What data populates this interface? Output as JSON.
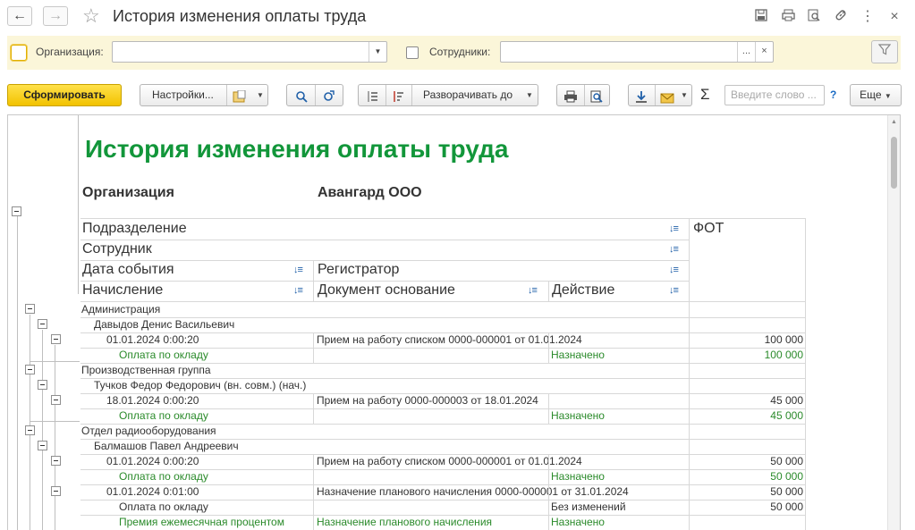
{
  "window": {
    "title": "История изменения оплаты труда",
    "back_icon": "←",
    "forward_icon": "→",
    "favorite_icon": "☆",
    "close_icon": "×",
    "more_icon": "⋮"
  },
  "filters": {
    "organization_label": "Организация:",
    "organization_value": "",
    "employees_label": "Сотрудники:",
    "employees_value": "",
    "employees_select": "...",
    "employees_clear": "×"
  },
  "toolbar": {
    "generate": "Сформировать",
    "settings": "Настройки...",
    "expand_to": "Разворачивать до",
    "search_placeholder": "Введите слово ...",
    "help": "?",
    "more": "Еще",
    "sum_icon": "Σ"
  },
  "report": {
    "title": "История изменения оплаты труда",
    "org_label": "Организация",
    "org_value": "Авангард ООО",
    "headers": {
      "department": "Подразделение",
      "employee": "Сотрудник",
      "event_date": "Дата события",
      "registrar": "Регистратор",
      "accrual": "Начисление",
      "base_document": "Документ основание",
      "action": "Действие",
      "fot": "ФОТ"
    },
    "rows": [
      {
        "kind": "dept",
        "c1": "Администрация",
        "c2": "",
        "c3": "",
        "fot": ""
      },
      {
        "kind": "emp",
        "c1": "Давыдов Денис Васильевич",
        "c2": "",
        "c3": "",
        "fot": ""
      },
      {
        "kind": "event",
        "c1": "01.01.2024 0:00:20",
        "c2": "Прием на работу списком 0000-000001 от 01.01.2024",
        "c3": "",
        "fot": "100 000"
      },
      {
        "kind": "accrual",
        "c1": "Оплата по окладу",
        "c2": "",
        "c3": "Назначено",
        "fot": "100 000"
      },
      {
        "kind": "dept",
        "c1": "Производственная группа",
        "c2": "",
        "c3": "",
        "fot": ""
      },
      {
        "kind": "emp",
        "c1": "Тучков Федор Федорович (вн. совм.) (нач.)",
        "c2": "",
        "c3": "",
        "fot": ""
      },
      {
        "kind": "event",
        "c1": "18.01.2024 0:00:20",
        "c2": "Прием на работу 0000-000003 от 18.01.2024",
        "c3": "",
        "fot": "45 000"
      },
      {
        "kind": "accrual",
        "c1": "Оплата по окладу",
        "c2": "",
        "c3": "Назначено",
        "fot": "45 000"
      },
      {
        "kind": "dept",
        "c1": "Отдел радиооборудования",
        "c2": "",
        "c3": "",
        "fot": ""
      },
      {
        "kind": "emp",
        "c1": "Балмашов Павел Андреевич",
        "c2": "",
        "c3": "",
        "fot": ""
      },
      {
        "kind": "event",
        "c1": "01.01.2024 0:00:20",
        "c2": "Прием на работу списком 0000-000001 от 01.01.2024",
        "c3": "",
        "fot": "50 000"
      },
      {
        "kind": "accrual",
        "c1": "Оплата по окладу",
        "c2": "",
        "c3": "Назначено",
        "fot": "50 000"
      },
      {
        "kind": "event",
        "c1": "01.01.2024 0:01:00",
        "c2": "Назначение планового начисления 0000-000001 от 31.01.2024",
        "c3": "",
        "fot": "50 000"
      },
      {
        "kind": "accrual_plain",
        "c1": "Оплата по окладу",
        "c2": "",
        "c3": "Без изменений",
        "fot": "50 000"
      },
      {
        "kind": "accrual",
        "c1": "Премия ежемесячная процентом",
        "c2": "Назначение планового начисления",
        "c3": "Назначено",
        "fot": ""
      }
    ]
  },
  "colors": {
    "title_green": "#12963a",
    "accrual_green": "#2a8a2a",
    "primary_button": "#f2c200",
    "filter_bar_bg": "#fbf6d9",
    "sort_blue": "#1f5fa8"
  }
}
